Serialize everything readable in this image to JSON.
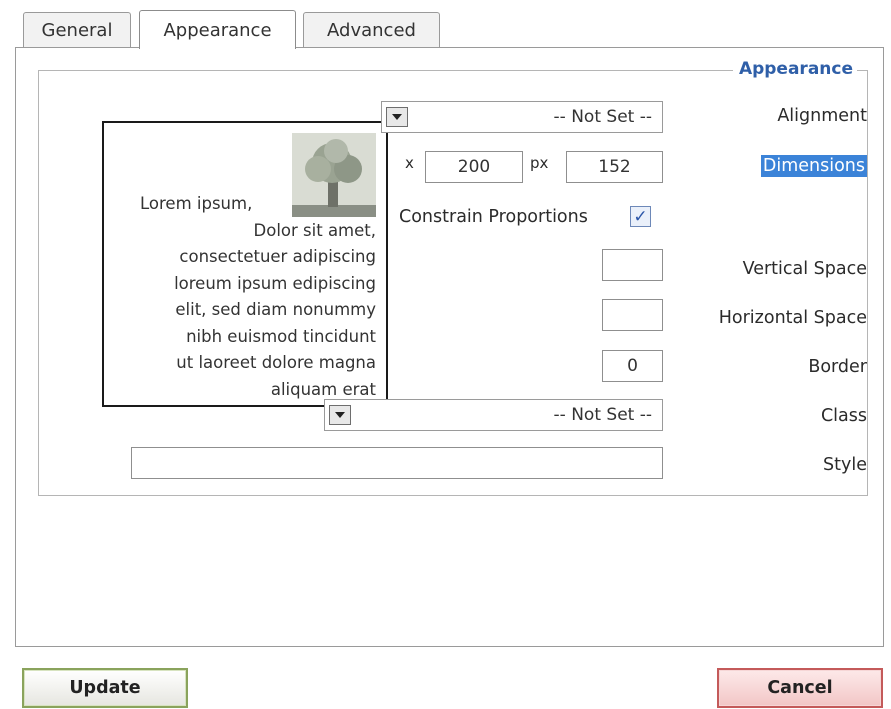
{
  "tabs": [
    {
      "label": "General"
    },
    {
      "label": "Appearance",
      "active": true
    },
    {
      "label": "Advanced"
    }
  ],
  "fieldset": {
    "legend": "Appearance"
  },
  "preview": {
    "lines": [
      "Lorem ipsum,",
      "Dolor sit amet,",
      "consectetuer adipiscing",
      "loreum ipsum edipiscing",
      "elit, sed diam nonummy",
      "nibh euismod tincidunt",
      "ut laoreet dolore magna",
      "aliquam erat"
    ],
    "image_icon": "tree-image"
  },
  "alignment": {
    "value": "-- Not Set --",
    "label": "Alignment"
  },
  "dimensions": {
    "x_prefix": "x",
    "width": "200",
    "unit": "px",
    "height": "152",
    "label": "Dimensions"
  },
  "constrain": {
    "label": "Constrain Proportions",
    "checked": true,
    "check_glyph": "✓"
  },
  "vertical_space": {
    "value": "",
    "label": "Vertical Space"
  },
  "horizontal_space": {
    "value": "",
    "label": "Horizontal Space"
  },
  "border": {
    "value": "0",
    "label": "Border"
  },
  "class": {
    "value": "-- Not Set --",
    "label": "Class"
  },
  "style": {
    "value": "",
    "label": "Style"
  },
  "buttons": {
    "update": "Update",
    "cancel": "Cancel"
  },
  "colors": {
    "legend": "#2f5fa8",
    "highlight": "#3b83d8",
    "update_border": "#8aa35c",
    "cancel_border": "#c45a5a"
  }
}
